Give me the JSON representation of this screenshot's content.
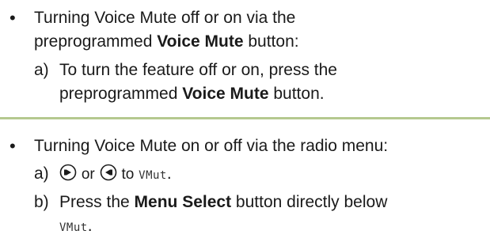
{
  "section1": {
    "bullet": "•",
    "line1": "Turning Voice Mute off or on via the",
    "line2_pre": "preprogrammed ",
    "line2_bold": "Voice Mute",
    "line2_post": " button:",
    "step_a_label": "a)",
    "step_a_line1": "To turn the feature off or on, press the",
    "step_a_line2_pre": "preprogrammed ",
    "step_a_line2_bold": "Voice Mute",
    "step_a_line2_post": " button."
  },
  "section2": {
    "bullet": "•",
    "line1": "Turning Voice Mute on or off via the radio menu:",
    "step_a_label": "a)",
    "step_a_or": "or",
    "step_a_to": "to",
    "step_a_lcd": "VMut",
    "step_a_end": ".",
    "step_b_label": "b)",
    "step_b_pre": "Press the ",
    "step_b_bold": "Menu Select",
    "step_b_post": " button directly below",
    "step_b_lcd": "VMut",
    "step_b_end": "."
  },
  "icons": {
    "right_nav": "right-nav-button-icon",
    "left_nav": "left-nav-button-icon"
  },
  "colors": {
    "divider": "#b5c98f",
    "text": "#1a1a1a"
  }
}
